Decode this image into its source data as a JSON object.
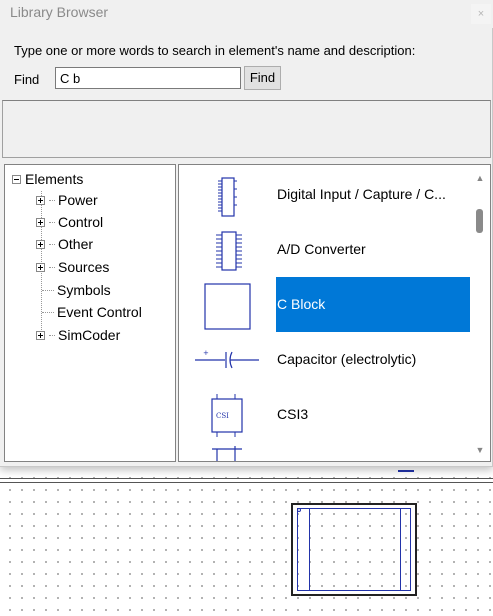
{
  "window": {
    "title": "Library Browser",
    "close_glyph": "×"
  },
  "search": {
    "instruction": "Type one or more words to search in element's name and  description:",
    "find_label": "Find",
    "find_value": "C b",
    "find_button": "Find"
  },
  "tree": {
    "root": "Elements",
    "items": [
      {
        "label": "Power",
        "expandable": true
      },
      {
        "label": "Control",
        "expandable": true
      },
      {
        "label": "Other",
        "expandable": true
      },
      {
        "label": "Sources",
        "expandable": true
      },
      {
        "label": "Symbols",
        "expandable": false
      },
      {
        "label": "Event Control",
        "expandable": false
      },
      {
        "label": "SimCoder",
        "expandable": true
      }
    ]
  },
  "list": {
    "items": [
      {
        "label": "Digital Input / Capture / C...",
        "icon": "digital-input-chip-icon",
        "selected": false
      },
      {
        "label": "A/D Converter",
        "icon": "ad-converter-chip-icon",
        "selected": false
      },
      {
        "label": "C Block",
        "icon": "c-block-icon",
        "selected": true
      },
      {
        "label": "Capacitor (electrolytic)",
        "icon": "capacitor-icon",
        "selected": false
      },
      {
        "label": "CSI3",
        "icon": "csi3-icon",
        "csi_text": "CSI",
        "selected": false
      }
    ],
    "scroll_up_glyph": "▲",
    "scroll_down_glyph": "▼"
  },
  "colors": {
    "selection": "#0078d7",
    "schematic_blue": "#2233aa"
  }
}
